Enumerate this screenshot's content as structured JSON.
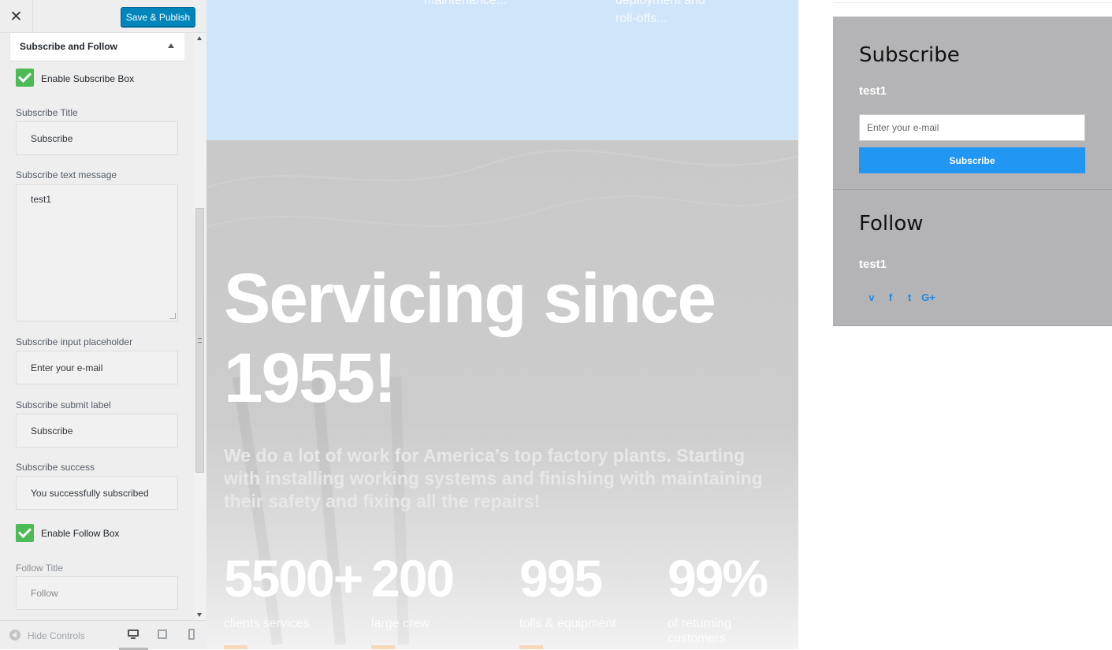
{
  "customizer": {
    "close_icon": "close-icon",
    "save_label": "Save & Publish",
    "section_title": "Subscribe and Follow",
    "enable_subscribe_label": "Enable Subscribe Box",
    "subscribe_title_label": "Subscribe Title",
    "subscribe_title_value": "Subscribe",
    "subscribe_text_label": "Subscribe text message",
    "subscribe_text_value": "test1",
    "placeholder_label": "Subscribe input placeholder",
    "placeholder_value": "Enter your e-mail",
    "submit_label_label": "Subscribe submit label",
    "submit_label_value": "Subscribe",
    "success_label": "Subscribe success",
    "success_value": "You successfully subscribed",
    "enable_follow_label": "Enable Follow Box",
    "follow_title_label": "Follow Title",
    "follow_title_value": "Follow",
    "hide_controls": "Hide Controls",
    "accent": "#0085ba",
    "check_color": "#4cba55"
  },
  "preview": {
    "snippets": [
      "maintenance...",
      "deployment and",
      "roll-offs..."
    ],
    "hero_title_line1": "Servicing since",
    "hero_title_line2": "1955!",
    "hero_text": "We do a lot of work for America’s top factory plants. Starting with installing working systems and finishing with maintaining their safety and fixing all the repairs!",
    "stats": [
      {
        "value": "5500+",
        "label": "clients services"
      },
      {
        "value": "200",
        "label": "large crew"
      },
      {
        "value": "995",
        "label": "tolls & equipment"
      },
      {
        "value": "99%",
        "label": "of returning customers"
      }
    ],
    "subscribe_widget": {
      "title": "Subscribe",
      "text": "test1",
      "email_placeholder": "Enter your e-mail",
      "button_label": "Subscribe",
      "button_color": "#2196f3"
    },
    "follow_widget": {
      "title": "Follow",
      "text": "test1",
      "social": [
        {
          "icon": "vimeo-icon",
          "glyph": "v"
        },
        {
          "icon": "facebook-icon",
          "glyph": "f"
        },
        {
          "icon": "twitter-icon",
          "glyph": "t"
        },
        {
          "icon": "google-plus-icon",
          "glyph": "G+"
        }
      ]
    }
  }
}
